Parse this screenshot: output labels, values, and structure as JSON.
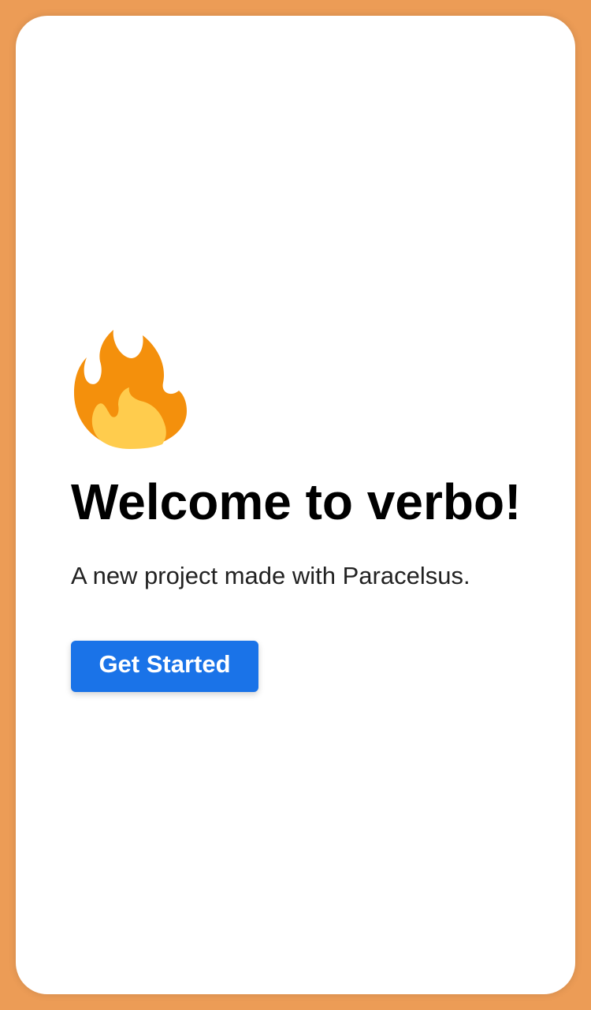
{
  "welcome": {
    "icon": "fire-icon",
    "title": "Welcome to verbo!",
    "subtitle": "A new project made with Paracelsus.",
    "cta_label": "Get Started"
  },
  "colors": {
    "background": "#EC9C56",
    "card": "#FFFFFF",
    "primary_button": "#1A73E8",
    "flame_outer": "#F4900C",
    "flame_inner": "#FFCC4D"
  }
}
